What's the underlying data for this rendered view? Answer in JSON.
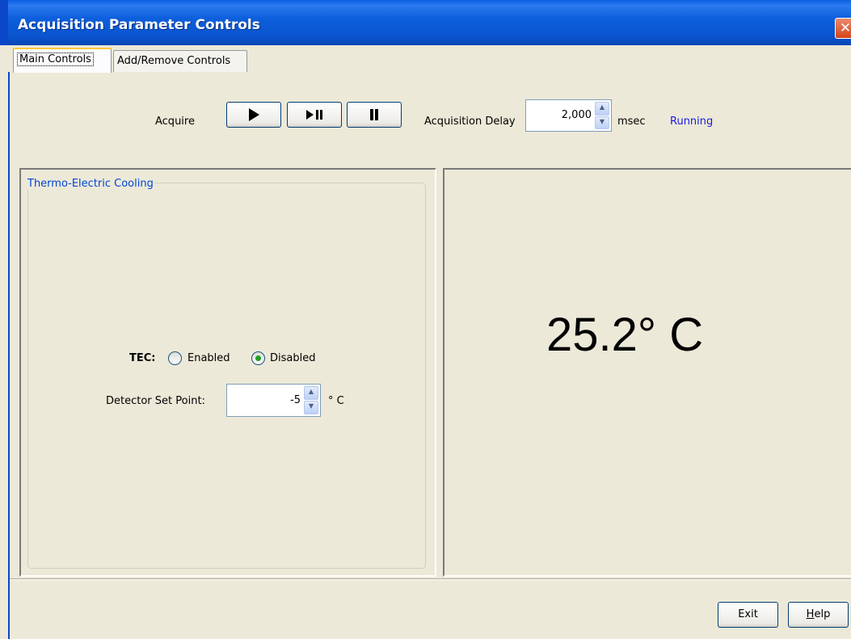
{
  "window": {
    "title": "Acquisition Parameter Controls",
    "close_glyph": "✕"
  },
  "tabs": [
    {
      "label": "Main Controls",
      "active": true
    },
    {
      "label": "Add/Remove Controls",
      "active": false
    }
  ],
  "acquire": {
    "label": "Acquire",
    "buttons": [
      "play-icon",
      "step-pause-icon",
      "pause-icon"
    ]
  },
  "acquisition_delay": {
    "label": "Acquisition Delay",
    "value": "2,000",
    "unit": "msec",
    "status": "Running"
  },
  "tec_panel": {
    "legend": "Thermo-Electric Cooling",
    "tec_label": "TEC:",
    "options": [
      {
        "label": "Enabled",
        "selected": false
      },
      {
        "label": "Disabled",
        "selected": true
      }
    ],
    "setpoint_label": "Detector Set Point:",
    "setpoint_value": "-5",
    "setpoint_unit": "° C"
  },
  "temperature": {
    "display": "25.2° C"
  },
  "footer": {
    "exit_label": "Exit",
    "help_first": "H",
    "help_rest": "elp"
  },
  "colors": {
    "title_bar": "#0a5fe0",
    "status_running": "#1a1ae6",
    "legend_text": "#0046d5",
    "radio_selected": "#21a121"
  }
}
